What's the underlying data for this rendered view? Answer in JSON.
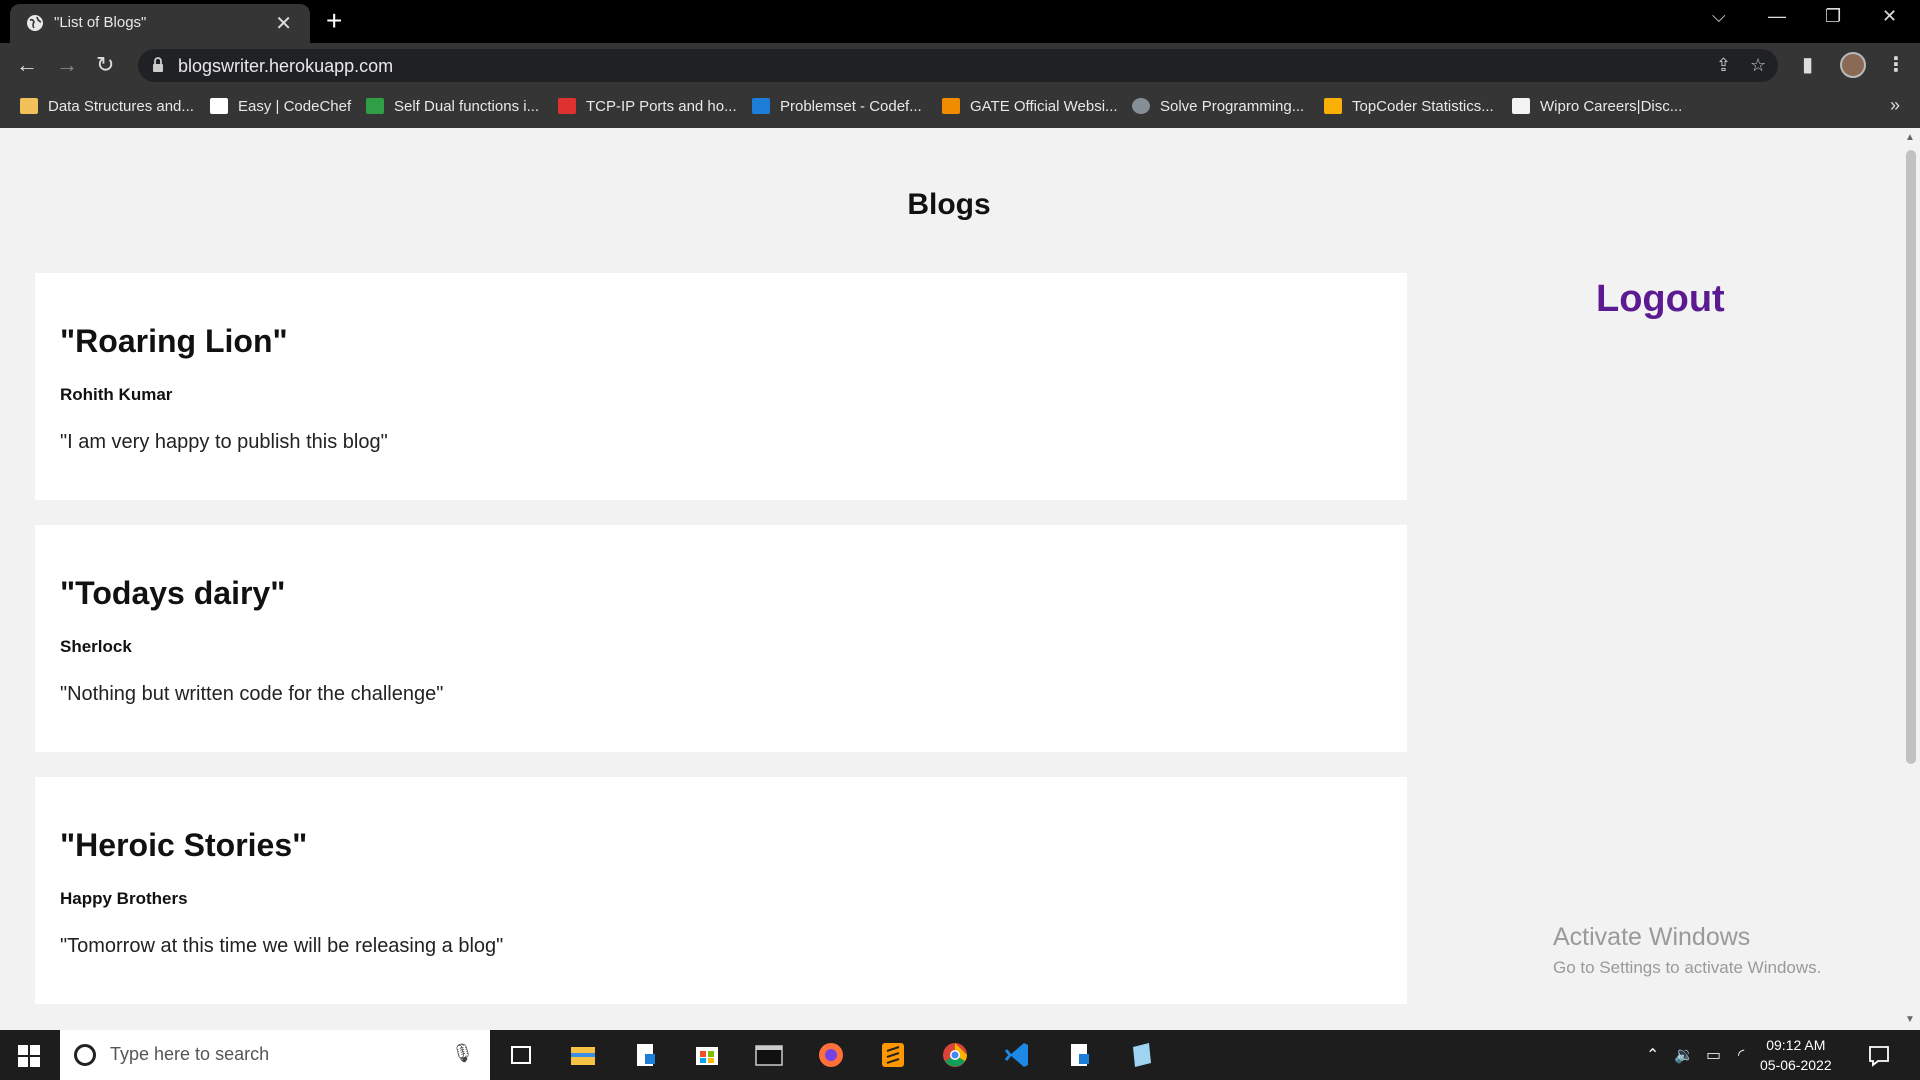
{
  "browser": {
    "tab_title": "\"List of Blogs\"",
    "tab_close": "✕",
    "new_tab": "+",
    "url": "blogswriter.herokuapp.com",
    "bookmarks": [
      {
        "label": "Data Structures and...",
        "color": "#f3c15a"
      },
      {
        "label": "Easy | CodeChef",
        "color": "#ffffff"
      },
      {
        "label": "Self Dual functions i...",
        "color": "#2f9e44"
      },
      {
        "label": "TCP-IP Ports and ho...",
        "color": "#e03131"
      },
      {
        "label": "Problemset - Codef...",
        "color": "#1c7ed6"
      },
      {
        "label": "GATE Official Websi...",
        "color": "#f08c00"
      },
      {
        "label": "Solve Programming...",
        "color": "#868e96"
      },
      {
        "label": "TopCoder Statistics...",
        "color": "#fab005"
      },
      {
        "label": "Wipro Careers|Disc...",
        "color": "#f1f3f5"
      }
    ],
    "more": "»"
  },
  "page": {
    "heading": "Blogs",
    "logout_label": "Logout",
    "blogs": [
      {
        "title": "\"Roaring Lion\"",
        "author": "Rohith Kumar",
        "body": "\"I am very happy to publish this blog\""
      },
      {
        "title": "\"Todays dairy\"",
        "author": "Sherlock",
        "body": "\"Nothing but written code for the challenge\""
      },
      {
        "title": "\"Heroic Stories\"",
        "author": "Happy Brothers",
        "body": "\"Tomorrow at this time we will be releasing a blog\""
      }
    ],
    "watermark": {
      "line1": "Activate Windows",
      "line2": "Go to Settings to activate Windows."
    }
  },
  "taskbar": {
    "search_placeholder": "Type here to search",
    "time": "09:12 AM",
    "date": "05-06-2022",
    "accent": "#7ab0e8"
  }
}
